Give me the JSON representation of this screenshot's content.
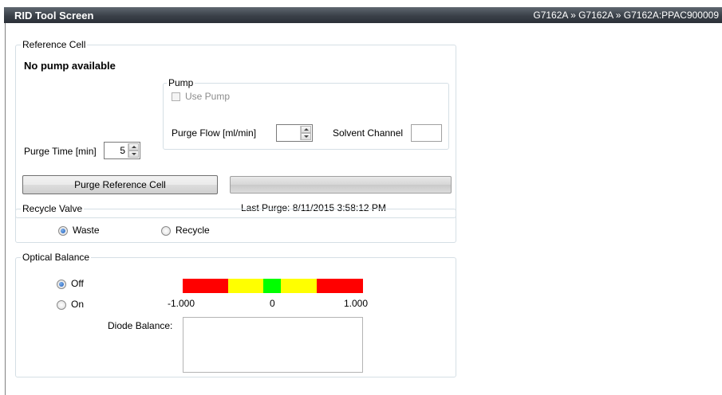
{
  "header": {
    "title": "RID Tool Screen",
    "breadcrumb": "G7162A » G7162A » G7162A:PPAC900009"
  },
  "reference_cell": {
    "legend": "Reference Cell",
    "pump_status": "No pump available",
    "purge_time_label": "Purge Time [min]",
    "purge_time_value": "5",
    "pump_group": {
      "legend": "Pump",
      "use_pump_label": "Use Pump",
      "use_pump_checked": false,
      "purge_flow_label": "Purge Flow [ml/min]",
      "purge_flow_value": "",
      "solvent_channel_label": "Solvent Channel",
      "solvent_channel_value": ""
    },
    "purge_button_label": "Purge Reference Cell",
    "purge_progress": 0,
    "last_purge": "Last Purge: 8/11/2015 3:58:12 PM"
  },
  "recycle_valve": {
    "legend": "Recycle Valve",
    "options": [
      {
        "label": "Waste",
        "selected": true
      },
      {
        "label": "Recycle",
        "selected": false
      }
    ]
  },
  "optical_balance": {
    "legend": "Optical Balance",
    "options": [
      {
        "label": "Off",
        "selected": true
      },
      {
        "label": "On",
        "selected": false
      }
    ],
    "scale_min": "-1.000",
    "scale_mid": "0",
    "scale_max": "1.000",
    "diode_balance_label": "Diode Balance:",
    "diode_balance_value": "",
    "colors": {
      "red": "#ff0000",
      "yellow": "#ffff00",
      "green": "#00ff00"
    }
  }
}
